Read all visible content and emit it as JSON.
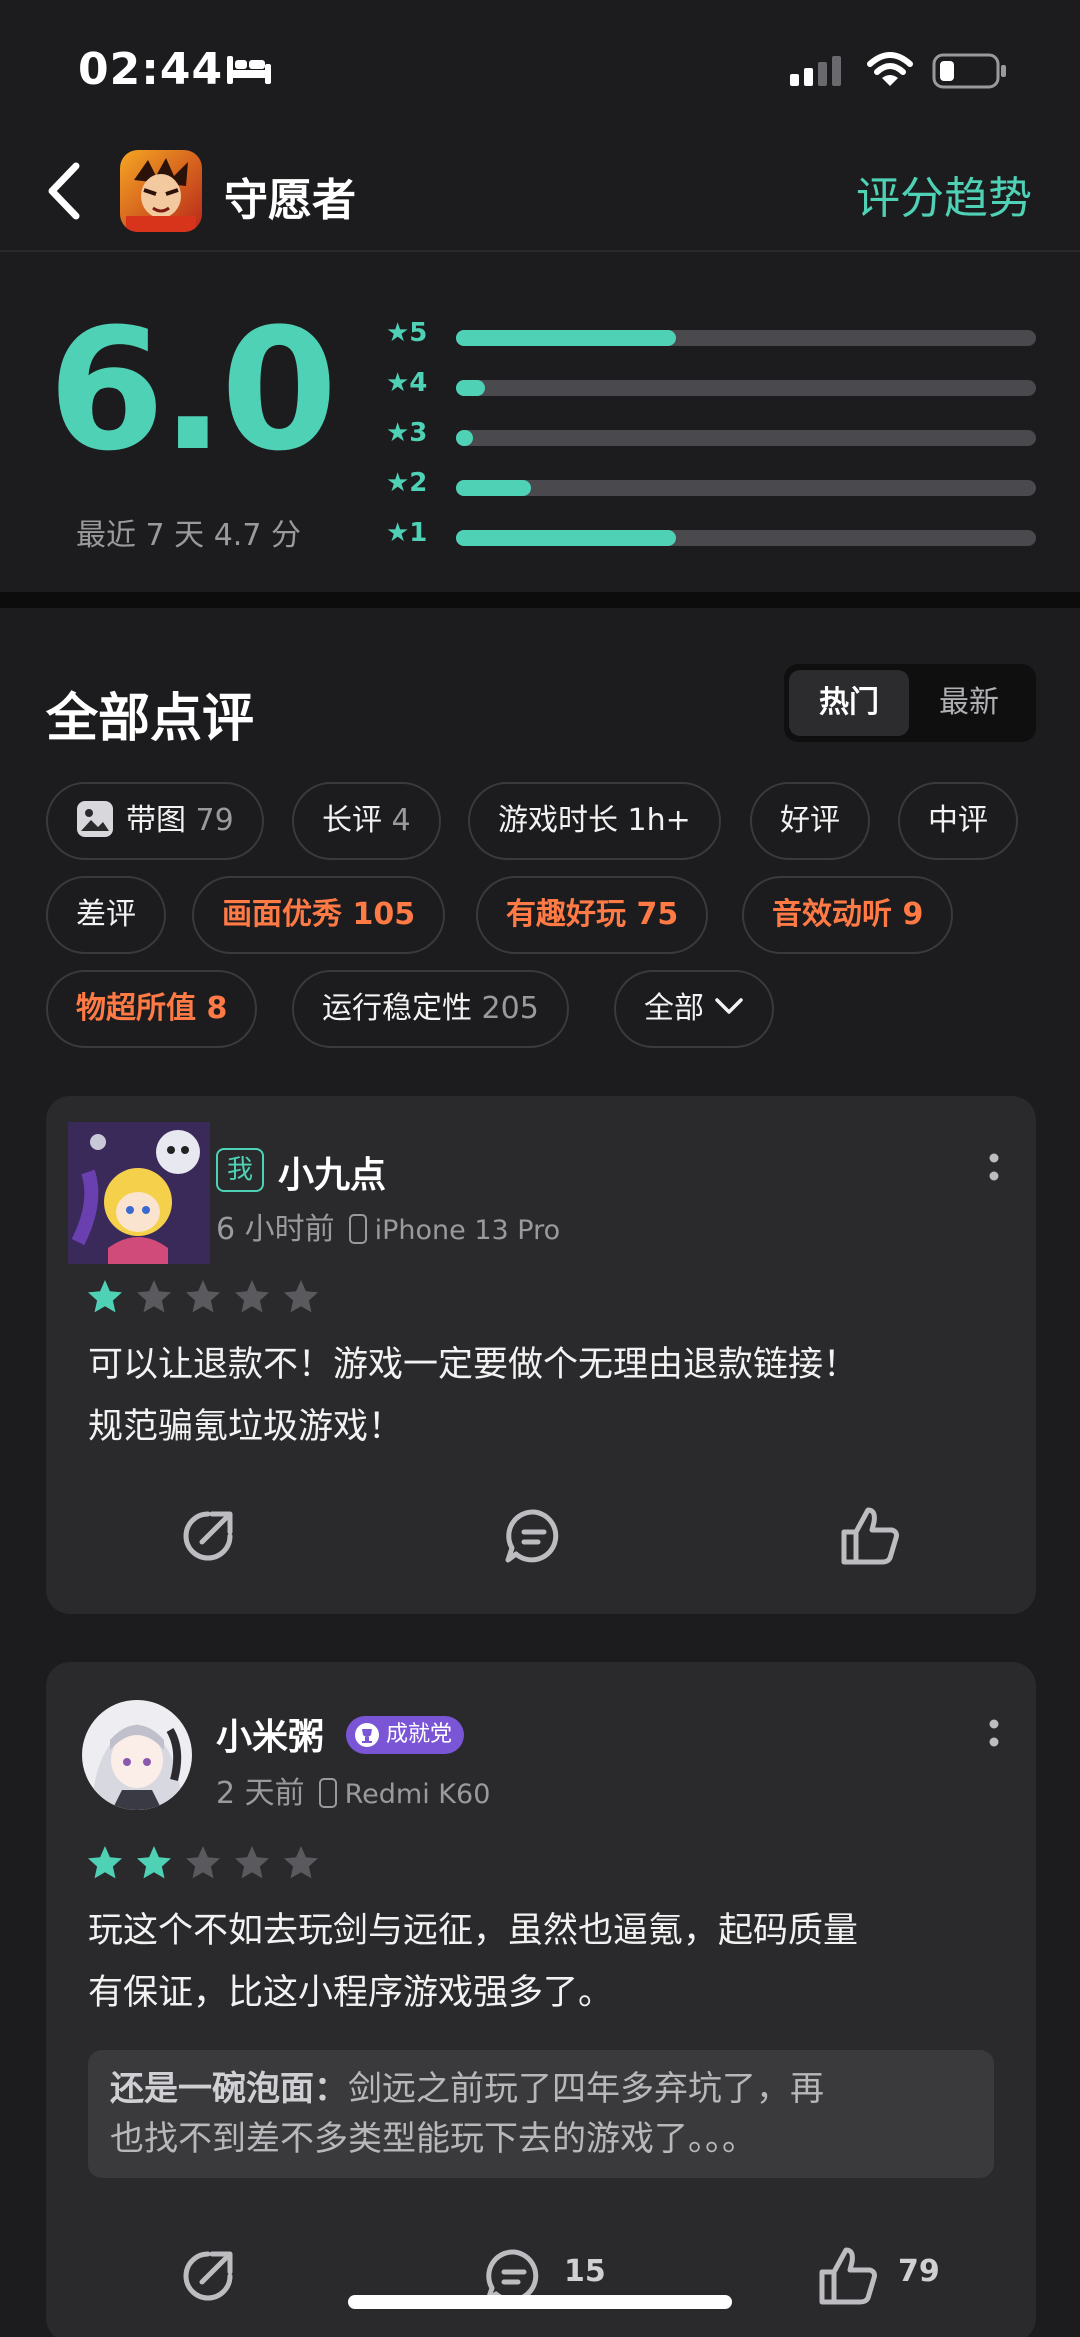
{
  "status": {
    "time": "02:44"
  },
  "header": {
    "title": "守愿者",
    "trend_link": "评分趋势"
  },
  "rating": {
    "score": "6.0",
    "recent": "最近 7 天 4.7 分",
    "distribution": [
      {
        "label": "★5",
        "fraction": 0.38
      },
      {
        "label": "★4",
        "fraction": 0.05
      },
      {
        "label": "★3",
        "fraction": 0.03
      },
      {
        "label": "★2",
        "fraction": 0.13
      },
      {
        "label": "★1",
        "fraction": 0.38
      }
    ]
  },
  "reviews_section": {
    "title": "全部点评",
    "sort": {
      "hot": "热门",
      "new": "最新"
    },
    "chips": [
      {
        "label": "带图",
        "count": "79"
      },
      {
        "label": "长评",
        "count": "4"
      },
      {
        "label": "游戏时长 1h+"
      },
      {
        "label": "好评"
      },
      {
        "label": "中评"
      },
      {
        "label": "差评"
      },
      {
        "label": "画面优秀",
        "count": "105"
      },
      {
        "label": "有趣好玩",
        "count": "75"
      },
      {
        "label": "音效动听",
        "count": "9"
      },
      {
        "label": "物超所值",
        "count": "8"
      },
      {
        "label": "运行稳定性",
        "count": "205"
      },
      {
        "label": "全部"
      }
    ]
  },
  "reviews": [
    {
      "me_badge": "我",
      "user": "小九点",
      "time": "6 小时前",
      "device": "iPhone 13 Pro",
      "stars": 1,
      "text_line1": "可以让退款不！游戏一定要做个无理由退款链接！",
      "text_line2": "规范骗氪垃圾游戏！"
    },
    {
      "user": "小米粥",
      "badge": "成就党",
      "time": "2 天前",
      "device": "Redmi K60",
      "stars": 2,
      "text_line1": "玩这个不如去玩剑与远征，虽然也逼氪，起码质量",
      "text_line2": "有保证，比这小程序游戏强多了。",
      "reply_author": "还是一碗泡面：",
      "reply_line1": "剑远之前玩了四年多弃坑了，再",
      "reply_line2": "也找不到差不多类型能玩下去的游戏了。。。",
      "comment_count": "15",
      "like_count": "79"
    }
  ],
  "colors": {
    "accent": "#4fd1b5",
    "tag_highlight": "#ff7a45",
    "badge_purple": "#7a55d6"
  }
}
